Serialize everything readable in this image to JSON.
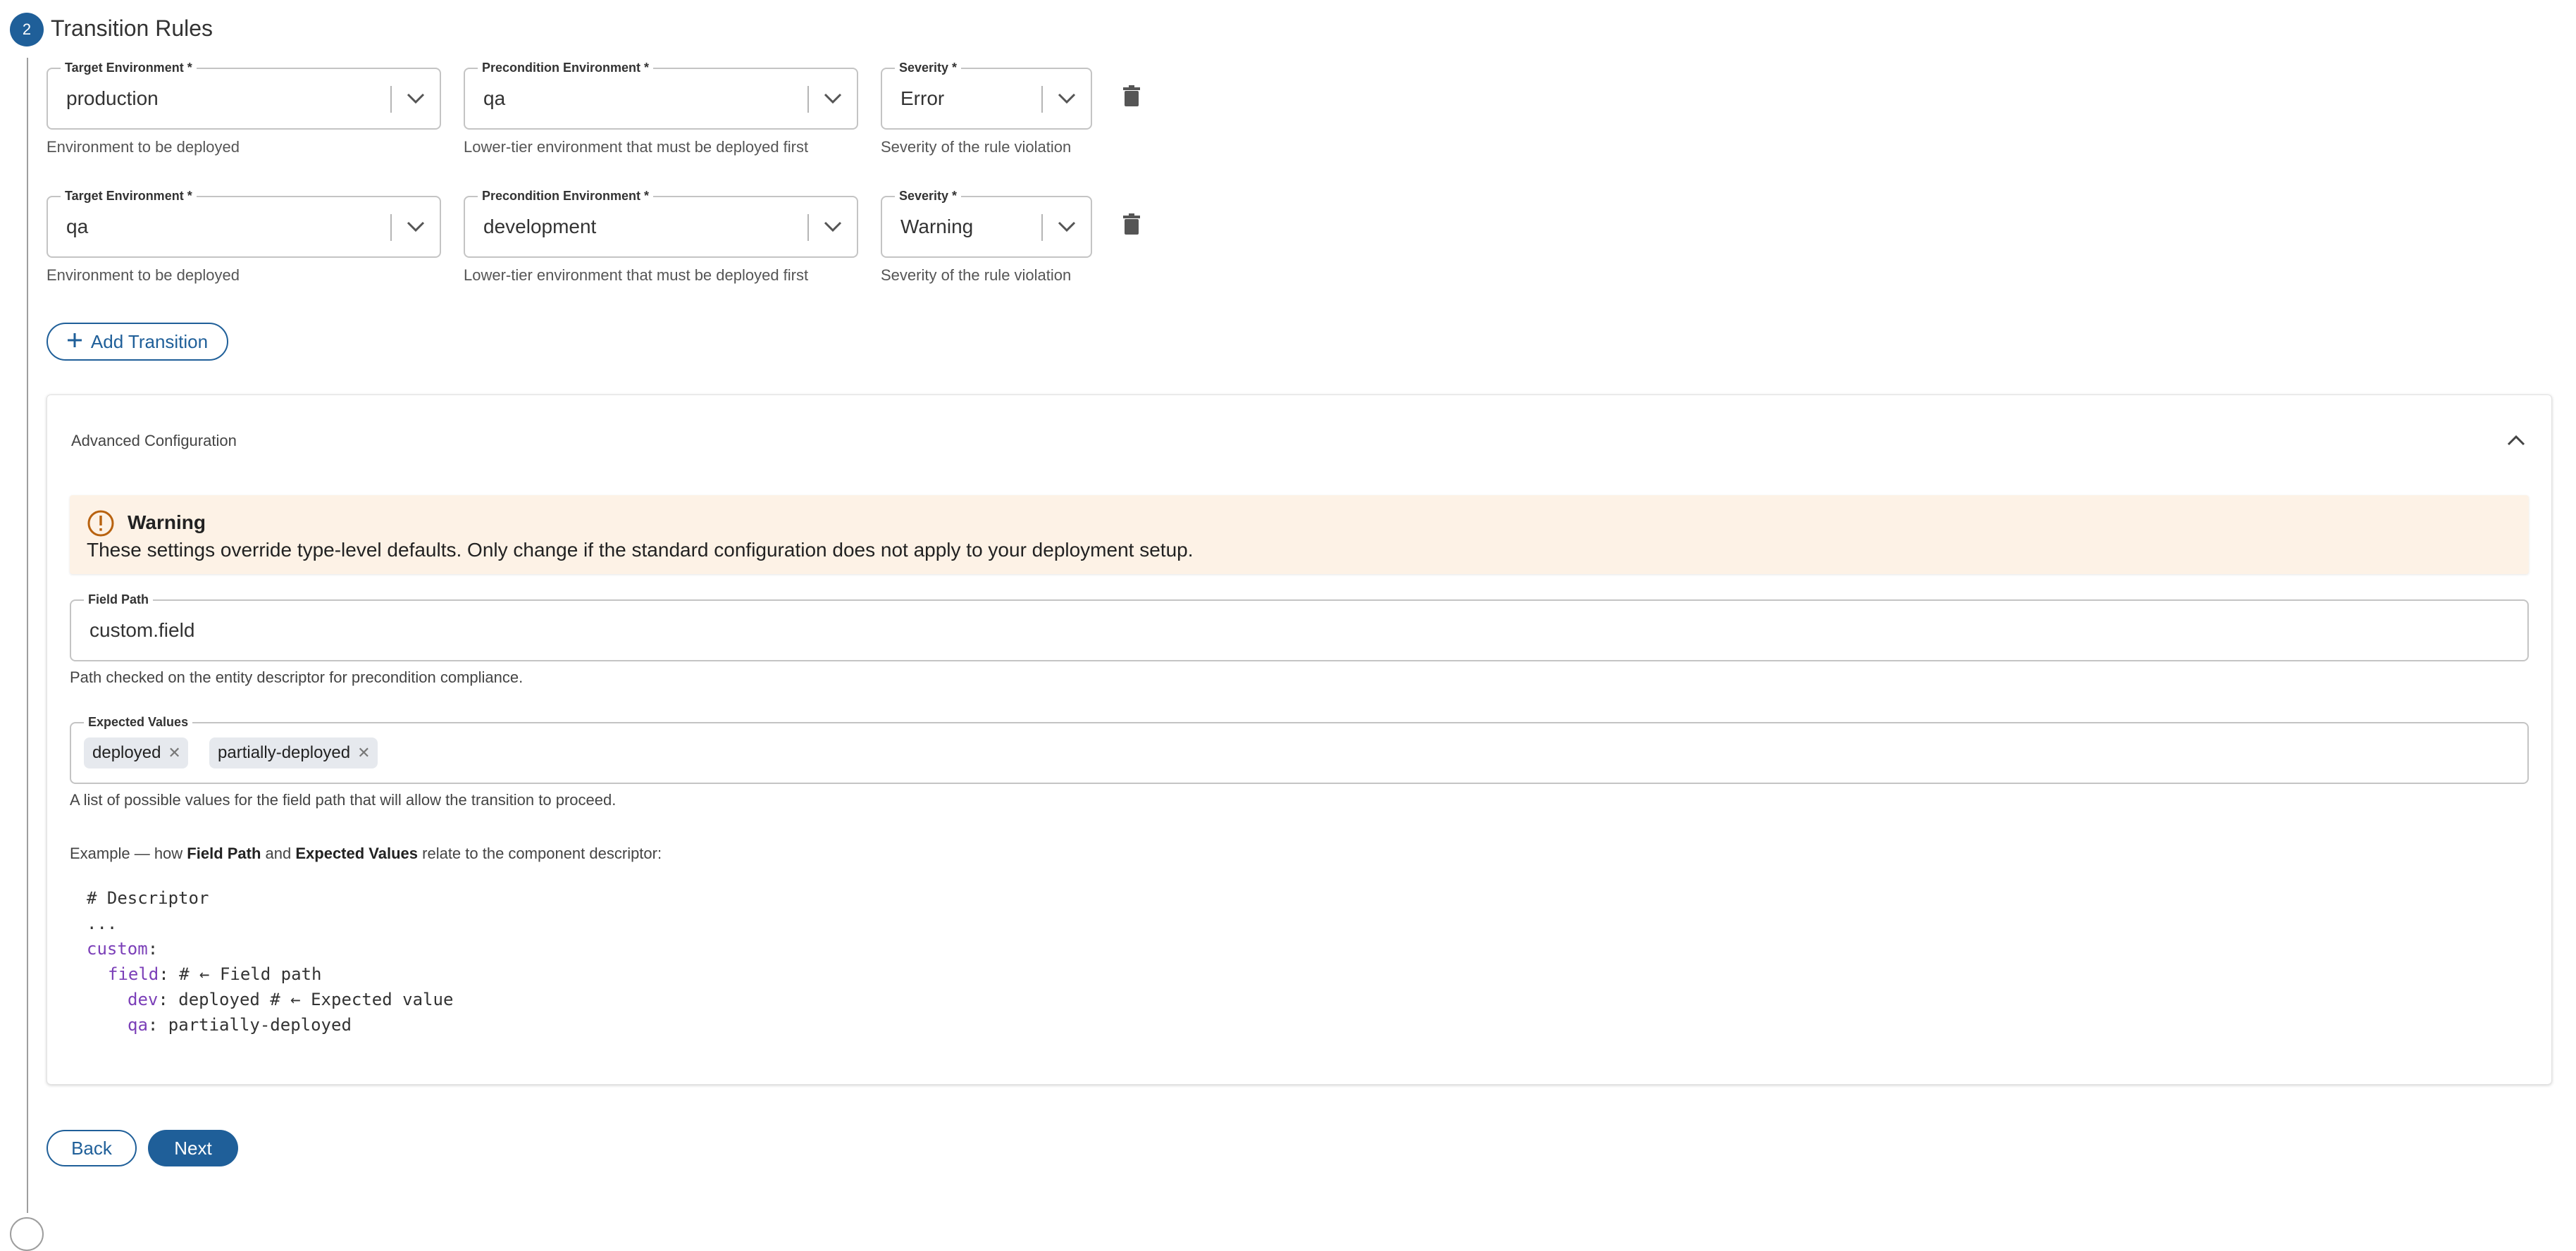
{
  "step": {
    "number": "2",
    "title": "Transition Rules"
  },
  "rules": [
    {
      "target_label": "Target Environment *",
      "target_value": "production",
      "target_helper": "Environment to be deployed",
      "precondition_label": "Precondition Environment *",
      "precondition_value": "qa",
      "precondition_helper": "Lower-tier environment that must be deployed first",
      "severity_label": "Severity *",
      "severity_value": "Error",
      "severity_helper": "Severity of the rule violation"
    },
    {
      "target_label": "Target Environment *",
      "target_value": "qa",
      "target_helper": "Environment to be deployed",
      "precondition_label": "Precondition Environment *",
      "precondition_value": "development",
      "precondition_helper": "Lower-tier environment that must be deployed first",
      "severity_label": "Severity *",
      "severity_value": "Warning",
      "severity_helper": "Severity of the rule violation"
    }
  ],
  "add_transition": {
    "icon": "plus-icon",
    "label": "Add Transition"
  },
  "advanced": {
    "title": "Advanced Configuration",
    "warning": {
      "title": "Warning",
      "text": "These settings override type-level defaults. Only change if the standard configuration does not apply to your deployment setup."
    },
    "field_path": {
      "label": "Field Path",
      "value": "custom.field",
      "helper": "Path checked on the entity descriptor for precondition compliance."
    },
    "expected_values": {
      "label": "Expected Values",
      "chips": [
        "deployed",
        "partially-deployed"
      ],
      "helper": "A list of possible values for the field path that will allow the transition to proceed."
    },
    "example": {
      "prefix": "Example — how ",
      "bold1": "Field Path",
      "middle": " and ",
      "bold2": "Expected Values",
      "suffix": " relate to the component descriptor:"
    },
    "code": {
      "line1": "# Descriptor",
      "line2": "...",
      "line3_key": "custom",
      "line3_rest": ":",
      "line4_key": "field",
      "line4_rest": ": # ← Field path",
      "line5_key": "dev",
      "line5_rest": ": deployed # ← Expected value",
      "line6_key": "qa",
      "line6_rest": ": partially-deployed"
    }
  },
  "nav": {
    "back": "Back",
    "next": "Next"
  },
  "colors": {
    "primary": "#1f5f99",
    "warning_bg": "#fdf2e6",
    "warning_icon": "#b8620f",
    "code_key": "#7b3fb8"
  }
}
